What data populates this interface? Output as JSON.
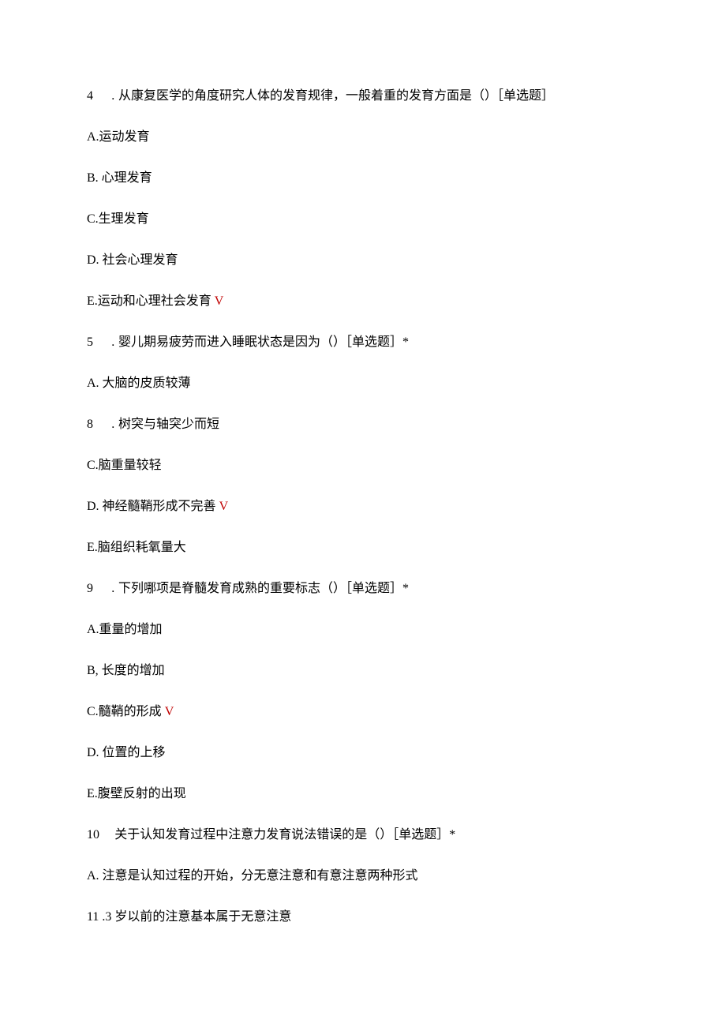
{
  "q4": {
    "num": "4",
    "dot": " .",
    "text": "从康复医学的角度研究人体的发育规律，一般着重的发育方面是（）［单选题］",
    "A": "A.运动发育",
    "B": "B. 心理发育",
    "C": "C.生理发育",
    "D": "D. 社会心理发育",
    "E_pre": "E.运动和心理社会发育",
    "E_mark": "V"
  },
  "q5": {
    "num": "5",
    "dot": " .",
    "text": "婴儿期易疲劳而进入睡眠状态是因为（）［单选题］*",
    "A": "A. 大脑的皮质较薄"
  },
  "q8": {
    "num": "8",
    "dot": " .",
    "text": "树突与轴突少而短",
    "C": "C.脑重量较轻",
    "D_pre": "D. 神经髓鞘形成不完善",
    "D_mark": "V",
    "E": "E.脑组织耗氧量大"
  },
  "q9": {
    "num": "9",
    "dot": " .",
    "text": "下列哪项是脊髓发育成熟的重要标志（）［单选题］*",
    "A": "A.重量的增加",
    "B": "B, 长度的增加",
    "C_pre": "C.髓鞘的形成",
    "C_mark": "V",
    "D": "D. 位置的上移",
    "E": "E.腹壁反射的出现"
  },
  "q10": {
    "num": "10",
    "text": "关于认知发育过程中注意力发育说法错误的是（）［单选题］*",
    "A": "A. 注意是认知过程的开始，分无意注意和有意注意两种形式"
  },
  "q11": {
    "num": "11 .",
    "text": "3 岁以前的注意基本属于无意注意"
  }
}
